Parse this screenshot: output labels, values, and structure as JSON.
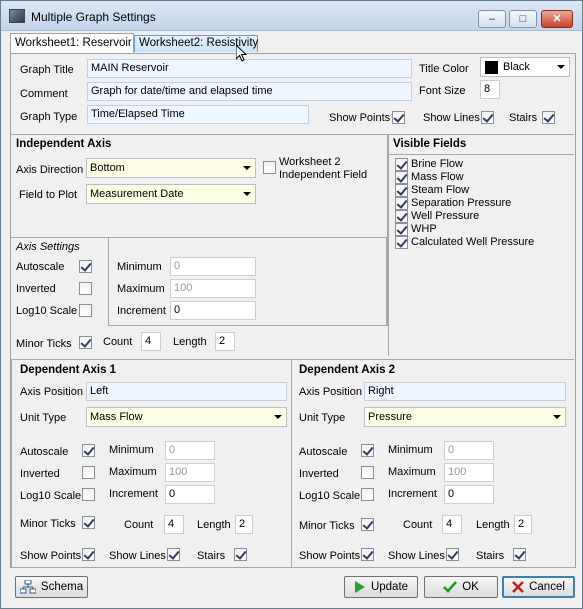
{
  "window": {
    "title": "Multiple Graph Settings",
    "minimize": "–",
    "maximize": "□",
    "close": "✕"
  },
  "tabs": [
    {
      "label": "Worksheet1: Reservoir"
    },
    {
      "label": "Worksheet2: Resistivity"
    }
  ],
  "graph": {
    "title_label": "Graph Title",
    "title_value": "MAIN Reservoir",
    "comment_label": "Comment",
    "comment_value": "Graph for date/time and elapsed time",
    "type_label": "Graph Type",
    "type_value": "Time/Elapsed Time",
    "title_color_label": "Title Color",
    "title_color_value": "Black",
    "title_color_swatch": "#000000",
    "font_size_label": "Font Size",
    "font_size_value": "8",
    "show_points_label": "Show Points",
    "show_lines_label": "Show Lines",
    "stairs_label": "Stairs"
  },
  "independent_axis": {
    "header": "Independent Axis",
    "direction_label": "Axis Direction",
    "direction_value": "Bottom",
    "field_label": "Field to Plot",
    "field_value": "Measurement Date",
    "ws2_label_line1": "Worksheet 2",
    "ws2_label_line2": "Independent Field",
    "settings_label": "Axis Settings",
    "autoscale_label": "Autoscale",
    "inverted_label": "Inverted",
    "log10_label": "Log10 Scale",
    "minimum_label": "Minimum",
    "minimum_value": "0",
    "maximum_label": "Maximum",
    "maximum_value": "100",
    "increment_label": "Increment",
    "increment_value": "0",
    "minor_ticks_label": "Minor Ticks",
    "count_label": "Count",
    "count_value": "4",
    "length_label": "Length",
    "length_value": "2"
  },
  "visible_fields": {
    "header": "Visible Fields",
    "items": [
      "Brine Flow",
      "Mass Flow",
      "Steam Flow",
      "Separation Pressure",
      "Well Pressure",
      "WHP",
      "Calculated Well Pressure"
    ]
  },
  "dep1": {
    "header": "Dependent Axis 1",
    "position_label": "Axis Position",
    "position_value": "Left",
    "unit_label": "Unit Type",
    "unit_value": "Mass Flow",
    "autoscale_label": "Autoscale",
    "inverted_label": "Inverted",
    "log10_label": "Log10 Scale",
    "minimum_label": "Minimum",
    "minimum_value": "0",
    "maximum_label": "Maximum",
    "maximum_value": "100",
    "increment_label": "Increment",
    "increment_value": "0",
    "minor_ticks_label": "Minor Ticks",
    "count_label": "Count",
    "count_value": "4",
    "length_label": "Length",
    "length_value": "2",
    "show_points_label": "Show Points",
    "show_lines_label": "Show Lines",
    "stairs_label": "Stairs"
  },
  "dep2": {
    "header": "Dependent Axis 2",
    "position_label": "Axis Position",
    "position_value": "Right",
    "unit_label": "Unit Type",
    "unit_value": "Pressure",
    "autoscale_label": "Autoscale",
    "inverted_label": "Inverted",
    "log10_label": "Log10 Scale",
    "minimum_label": "Minimum",
    "minimum_value": "0",
    "maximum_label": "Maximum",
    "maximum_value": "100",
    "increment_label": "Increment",
    "increment_value": "0",
    "minor_ticks_label": "Minor Ticks",
    "count_label": "Count",
    "count_value": "4",
    "length_label": "Length",
    "length_value": "2",
    "show_points_label": "Show Points",
    "show_lines_label": "Show Lines",
    "stairs_label": "Stairs"
  },
  "footer": {
    "schema_label": "Schema",
    "update_label": "Update",
    "ok_label": "OK",
    "cancel_label": "Cancel"
  }
}
